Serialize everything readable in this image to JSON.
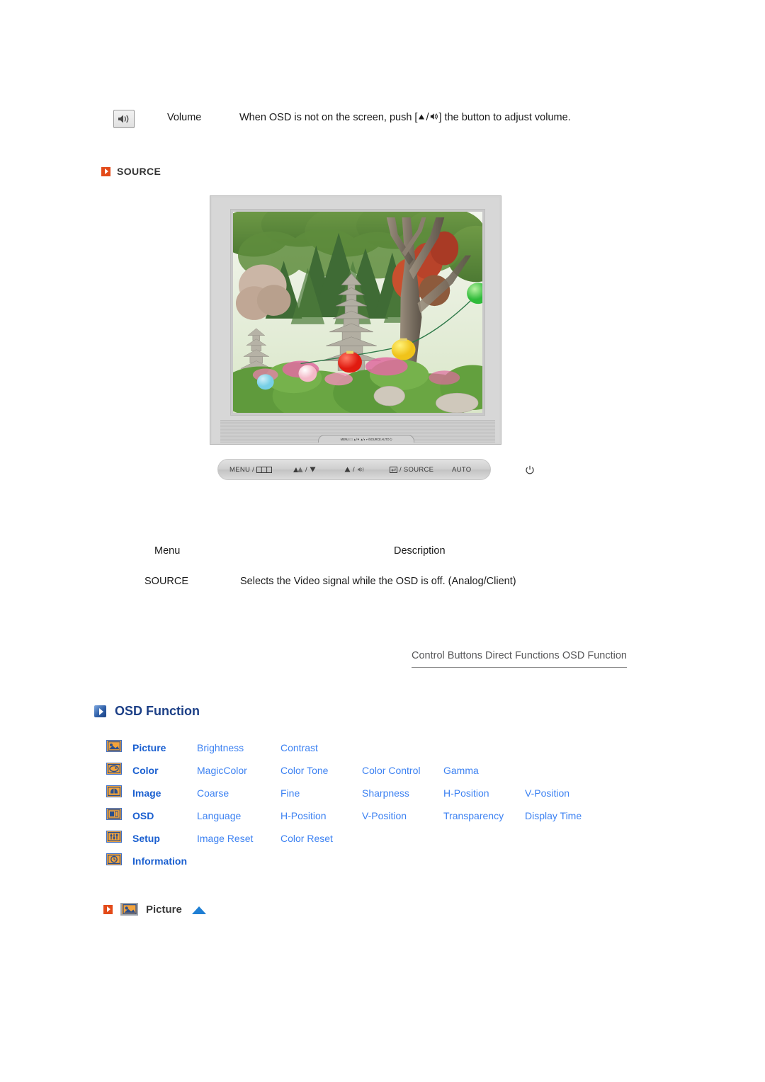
{
  "volume_row": {
    "icon": "speaker-volume-icon",
    "label": "Volume",
    "description_prefix": "When OSD is not on the screen, push [",
    "description_suffix": "] the button to adjust volume.",
    "description_full": "When OSD is not on the screen, push [▲/◐] the button to adjust volume."
  },
  "source_section": {
    "bullet_color": "#e34a19",
    "heading": "SOURCE"
  },
  "monitor": {
    "alt": "LCD monitor displaying a garden photo with a stone pagoda, trees and colorful paper lanterns",
    "front_panel_labels": [
      "MENU /",
      "/",
      "/",
      "/ SOURCE",
      "AUTO"
    ],
    "control_bar": [
      {
        "label": "MENU /",
        "icon": "osd-menu-icon"
      },
      {
        "label": "/",
        "icon": "magicbright-down-icon"
      },
      {
        "label": "/",
        "icon": "up-volume-icon"
      },
      {
        "label": "/ SOURCE",
        "icon": "enter-icon"
      },
      {
        "label": "AUTO",
        "icon": ""
      },
      {
        "label": "",
        "icon": "power-icon"
      }
    ],
    "mini_panel_text": "MENU □□  ▲/▼  ▲/◐  ↵/SOURCE  AUTO  ⏻"
  },
  "table": {
    "headers": {
      "menu": "Menu",
      "description": "Description"
    },
    "rows": [
      {
        "menu": "SOURCE",
        "description": "Selects the Video signal while the OSD is off. (Analog/Client)"
      }
    ]
  },
  "nav_tabs": [
    {
      "label": "Control Buttons"
    },
    {
      "label": "Direct Functions"
    },
    {
      "label": "OSD Function"
    }
  ],
  "osd_function": {
    "bullet_color": "#2f5fa8",
    "heading": "OSD Function",
    "menu_color": "#1a5fd0",
    "sub_color": "#3d82f2",
    "icon_color": "#f2a33c",
    "rows": [
      {
        "icon": "picture-icon",
        "category": "Picture",
        "items": [
          "Brightness",
          "Contrast"
        ]
      },
      {
        "icon": "color-icon",
        "category": "Color",
        "items": [
          "MagicColor",
          "Color Tone",
          "Color Control",
          "Gamma"
        ]
      },
      {
        "icon": "image-icon",
        "category": "Image",
        "items": [
          "Coarse",
          "Fine",
          "Sharpness",
          "H-Position",
          "V-Position"
        ]
      },
      {
        "icon": "osd-icon",
        "category": "OSD",
        "items": [
          "Language",
          "H-Position",
          "V-Position",
          "Transparency",
          "Display Time"
        ]
      },
      {
        "icon": "setup-icon",
        "category": "Setup",
        "items": [
          "Image Reset",
          "Color Reset"
        ]
      },
      {
        "icon": "information-icon",
        "category": "Information",
        "items": []
      }
    ]
  },
  "picture_footer": {
    "bullet_color": "#e34a19",
    "icon": "picture-icon",
    "label": "Picture",
    "arrow": "up-triangle-icon",
    "arrow_color": "#1f7fd4"
  }
}
